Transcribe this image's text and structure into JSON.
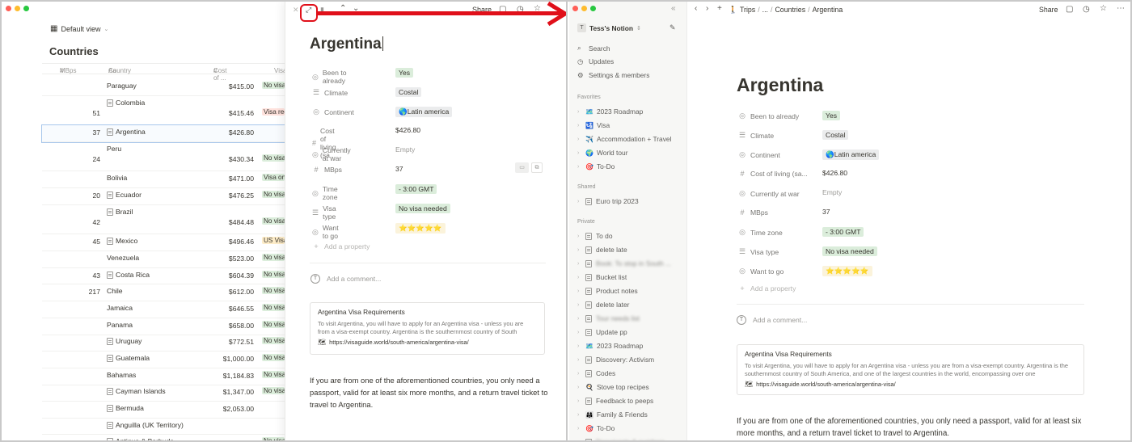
{
  "left": {
    "view_label": "Default view",
    "db_title": "Countries",
    "columns": [
      "MBps",
      "Country",
      "Cost of ...",
      "Visa"
    ],
    "rows": [
      {
        "mbps": "",
        "country": "Paraguay",
        "doc": false,
        "cost": "$415.00",
        "visa": "No visa needed",
        "vc": "vg"
      },
      {
        "mbps": "51",
        "country": "Colombia",
        "doc": true,
        "cost": "$415.46",
        "visa": "Visa required",
        "vc": "vr"
      },
      {
        "mbps": "37",
        "country": "Argentina",
        "doc": true,
        "cost": "$426.80",
        "visa": "",
        "vc": ""
      },
      {
        "mbps": "24",
        "country": "Peru",
        "doc": false,
        "cost": "$430.34",
        "visa": "No visa needed",
        "vc": "vg"
      },
      {
        "mbps": "",
        "country": "Bolivia",
        "doc": false,
        "cost": "$471.00",
        "visa": "Visa on arrival",
        "vc": "vg"
      },
      {
        "mbps": "20",
        "country": "Ecuador",
        "doc": true,
        "cost": "$476.25",
        "visa": "No visa needed",
        "vc": "vg"
      },
      {
        "mbps": "42",
        "country": "Brazil",
        "doc": true,
        "cost": "$484.48",
        "visa": "No visa needed",
        "vc": "vg"
      },
      {
        "mbps": "45",
        "country": "Mexico",
        "doc": true,
        "cost": "$496.46",
        "visa": "US Visa",
        "vc": "vy"
      },
      {
        "mbps": "",
        "country": "Venezuela",
        "doc": false,
        "cost": "$523.00",
        "visa": "No visa needed",
        "vc": "vg"
      },
      {
        "mbps": "43",
        "country": "Costa Rica",
        "doc": true,
        "cost": "$604.39",
        "visa": "No visa needed",
        "vc": "vg"
      },
      {
        "mbps": "217",
        "country": "Chile",
        "doc": false,
        "cost": "$612.00",
        "visa": "No visa needed",
        "vc": "vg"
      },
      {
        "mbps": "",
        "country": "Jamaica",
        "doc": false,
        "cost": "$646.55",
        "visa": "No visa needed",
        "vc": "vg"
      },
      {
        "mbps": "",
        "country": "Panama",
        "doc": false,
        "cost": "$658.00",
        "visa": "No visa needed",
        "vc": "vg"
      },
      {
        "mbps": "",
        "country": "Uruguay",
        "doc": true,
        "cost": "$772.51",
        "visa": "No visa needed",
        "vc": "vg"
      },
      {
        "mbps": "",
        "country": "Guatemala",
        "doc": true,
        "cost": "$1,000.00",
        "visa": "No visa needed",
        "vc": "vg"
      },
      {
        "mbps": "",
        "country": "Bahamas",
        "doc": false,
        "cost": "$1,184.83",
        "visa": "No visa needed",
        "vc": "vg"
      },
      {
        "mbps": "",
        "country": "Cayman Islands",
        "doc": true,
        "cost": "$1,347.00",
        "visa": "No visa needed",
        "vc": "vg"
      },
      {
        "mbps": "",
        "country": "Bermuda",
        "doc": true,
        "cost": "$2,053.00",
        "visa": "",
        "vc": ""
      },
      {
        "mbps": "",
        "country": "Anguilla (UK Territory)",
        "doc": true,
        "cost": "",
        "visa": "",
        "vc": ""
      },
      {
        "mbps": "",
        "country": "Antigua & Barbuda",
        "doc": true,
        "cost": "",
        "visa": "No visa needed",
        "vc": "vg"
      }
    ]
  },
  "peek": {
    "share": "Share",
    "title": "Argentina",
    "add_property": "Add a property",
    "add_comment": "Add a comment...",
    "card_title": "Argentina Visa Requirements",
    "card_desc": "To visit Argentina, you will have to apply for an Argentina visa - unless you are from a visa-exempt country. Argentina is the southernmost country of South",
    "card_url": "https://visaguide.world/south-america/argentina-visa/",
    "para": "If you are from one of the aforementioned countries, you only need a passport, valid for at least six more months, and a return travel ticket to travel to Argentina."
  },
  "props": {
    "labels": [
      "Been to already",
      "Climate",
      "Continent",
      "Cost of living (sa...",
      "Currently at war",
      "MBps",
      "Time zone",
      "Visa type",
      "Want to go"
    ],
    "been": "Yes",
    "climate": "Costal",
    "continent": "🌎Latin america",
    "cost": "$426.80",
    "war": "Empty",
    "mbps": "37",
    "tz": "- 3:00 GMT",
    "visa": "No visa needed",
    "want": "⭐⭐⭐⭐⭐"
  },
  "sidebar": {
    "workspace": "Tess's Notion",
    "top": [
      "Search",
      "Updates",
      "Settings & members"
    ],
    "favorites_label": "Favorites",
    "favorites": [
      {
        "icon": "🗺️",
        "label": "2023 Roadmap"
      },
      {
        "icon": "🛂",
        "label": "Visa"
      },
      {
        "icon": "✈️",
        "label": "Accommodation + Travel"
      },
      {
        "icon": "🌍",
        "label": "World tour"
      },
      {
        "icon": "🎯",
        "label": "To-Do"
      }
    ],
    "shared_label": "Shared",
    "shared": [
      {
        "icon": "",
        "label": "Euro trip 2023"
      }
    ],
    "private_label": "Private",
    "private": [
      {
        "icon": "",
        "label": "To do",
        "blur": false
      },
      {
        "icon": "",
        "label": "delete late",
        "blur": false
      },
      {
        "icon": "",
        "label": "Book: To stop in South ...",
        "blur": true
      },
      {
        "icon": "",
        "label": "Bucket list",
        "blur": false
      },
      {
        "icon": "",
        "label": "Product notes",
        "blur": false
      },
      {
        "icon": "",
        "label": "delete later",
        "blur": false
      },
      {
        "icon": "",
        "label": "Tour needs list",
        "blur": true
      },
      {
        "icon": "",
        "label": "Update pp",
        "blur": false
      },
      {
        "icon": "🗺️",
        "label": "2023 Roadmap",
        "blur": false
      },
      {
        "icon": "",
        "label": "Discovery: Activism",
        "blur": false
      },
      {
        "icon": "",
        "label": "Codes",
        "blur": false
      },
      {
        "icon": "🍳",
        "label": "Stove top recipes",
        "blur": false
      },
      {
        "icon": "",
        "label": "Feedback to peeps",
        "blur": false
      },
      {
        "icon": "👨‍👩‍👧",
        "label": "Family & Friends",
        "blur": false
      },
      {
        "icon": "🎯",
        "label": "To-Do",
        "blur": false
      },
      {
        "icon": "",
        "label": "Documents & numbers",
        "blur": true
      }
    ]
  },
  "right": {
    "breadcrumb": [
      "Trips",
      "...",
      "Countries",
      "Argentina"
    ],
    "share": "Share",
    "title": "Argentina",
    "add_property": "Add a property",
    "add_comment": "Add a comment...",
    "card_title": "Argentina Visa Requirements",
    "card_desc": "To visit Argentina, you will have to apply for an Argentina visa - unless you are from a visa-exempt country. Argentina is the southernmost country of South America, and one of the largest countries in the world, encompassing over one",
    "card_url": "https://visaguide.world/south-america/argentina-visa/",
    "para": "If you are from one of the aforementioned countries, you only need a passport, valid for at least six more months, and a return travel ticket to travel to Argentina."
  }
}
